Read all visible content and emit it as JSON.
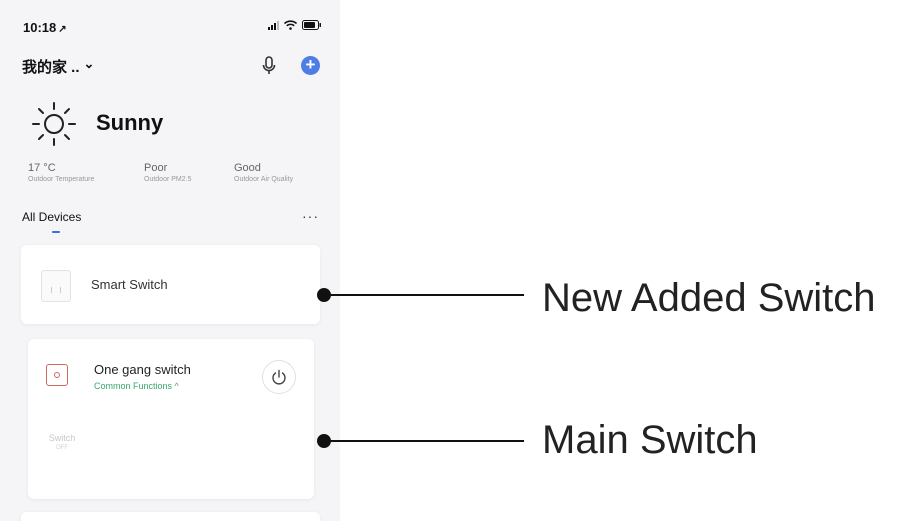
{
  "status_bar": {
    "time": "10:18",
    "location_arrow": "↗"
  },
  "header": {
    "home_name": "我的家 ..",
    "home_chevron": "⌄",
    "mic_icon": "microphone-icon",
    "add_icon": "plus-circle-icon",
    "add_symbol": "+"
  },
  "weather": {
    "condition": "Sunny",
    "icon": "sun-icon",
    "metrics": [
      {
        "value": "17 °C",
        "label": "Outdoor Temperature"
      },
      {
        "value": "Poor",
        "label": "Outdoor PM2.5"
      },
      {
        "value": "Good",
        "label": "Outdoor Air Quality"
      }
    ]
  },
  "devices": {
    "section_title": "All Devices",
    "more_symbol": "···",
    "new_device": {
      "name": "Smart Switch"
    },
    "main_device": {
      "name": "One gang switch",
      "functions_link": "Common Functions ^",
      "control_label": "Switch",
      "control_state": "OFF"
    }
  },
  "callouts": {
    "new_added": "New Added Switch",
    "main": "Main Switch"
  },
  "colors": {
    "accent_blue": "#4c7ee6",
    "functions_green": "#3aa86b",
    "gang_icon_red": "#d06a5c",
    "phone_background": "#f5f5f7"
  }
}
